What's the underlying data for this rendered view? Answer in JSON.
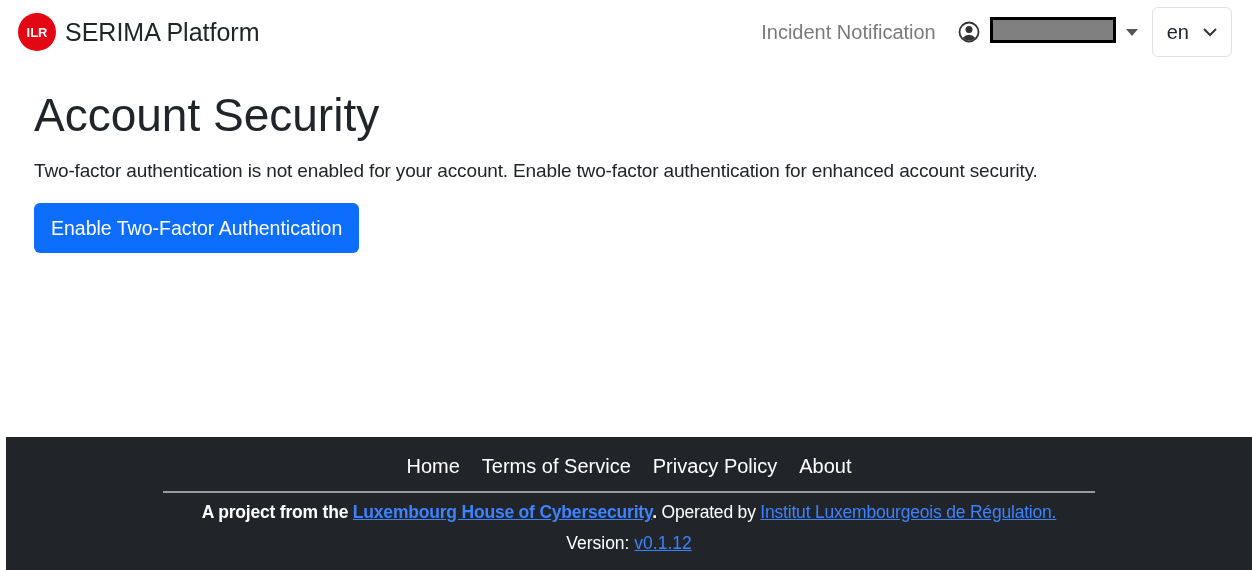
{
  "navbar": {
    "logo_mark": "ILR",
    "brand": "SERIMA Platform",
    "links": [
      {
        "label": "Incident Notification"
      }
    ],
    "user_menu": {
      "redacted": true
    },
    "language": {
      "value": "en"
    }
  },
  "main": {
    "title": "Account Security",
    "message": "Two-factor authentication is not enabled for your account. Enable two-factor authentication for enhanced account security.",
    "button": "Enable Two-Factor Authentication"
  },
  "footer": {
    "links": [
      {
        "label": "Home"
      },
      {
        "label": "Terms of Service"
      },
      {
        "label": "Privacy Policy"
      },
      {
        "label": "About"
      }
    ],
    "credit": {
      "prefix": "A project from the",
      "link_1": "Luxembourg House of Cybersecurity",
      "middle": ". Operated by",
      "link_2": "Institut Luxembourgeois de Régulation."
    },
    "version_label": "Version:",
    "version": "v0.1.12"
  }
}
